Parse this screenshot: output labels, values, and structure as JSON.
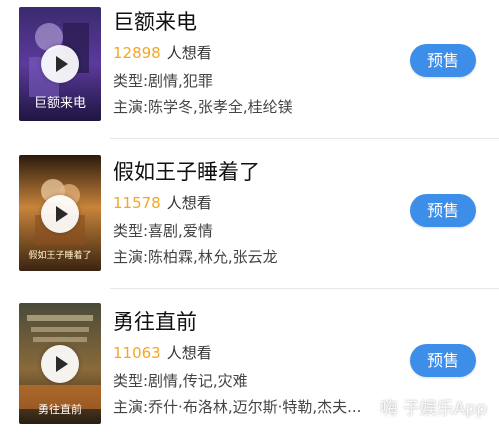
{
  "movies": [
    {
      "title": "巨额来电",
      "want_count": "12898",
      "want_suffix": "人想看",
      "genre": "类型:剧情,犯罪",
      "cast": "主演:陈学冬,张孝全,桂纶镁",
      "button": "预售",
      "poster_text": "巨额来电"
    },
    {
      "title": "假如王子睡着了",
      "want_count": "11578",
      "want_suffix": "人想看",
      "genre": "类型:喜剧,爱情",
      "cast": "主演:陈柏霖,林允,张云龙",
      "button": "预售",
      "poster_text": "假如王子睡着了"
    },
    {
      "title": "勇往直前",
      "want_count": "11063",
      "want_suffix": "人想看",
      "genre": "类型:剧情,传记,灾难",
      "cast": "主演:乔什·布洛林,迈尔斯·特勒,杰夫...",
      "button": "预售",
      "poster_text": "勇往直前"
    }
  ],
  "watermark": "嗨 子娱乐App",
  "colors": {
    "want_count": "#f5a623",
    "presale_button": "#3d8ee8"
  }
}
